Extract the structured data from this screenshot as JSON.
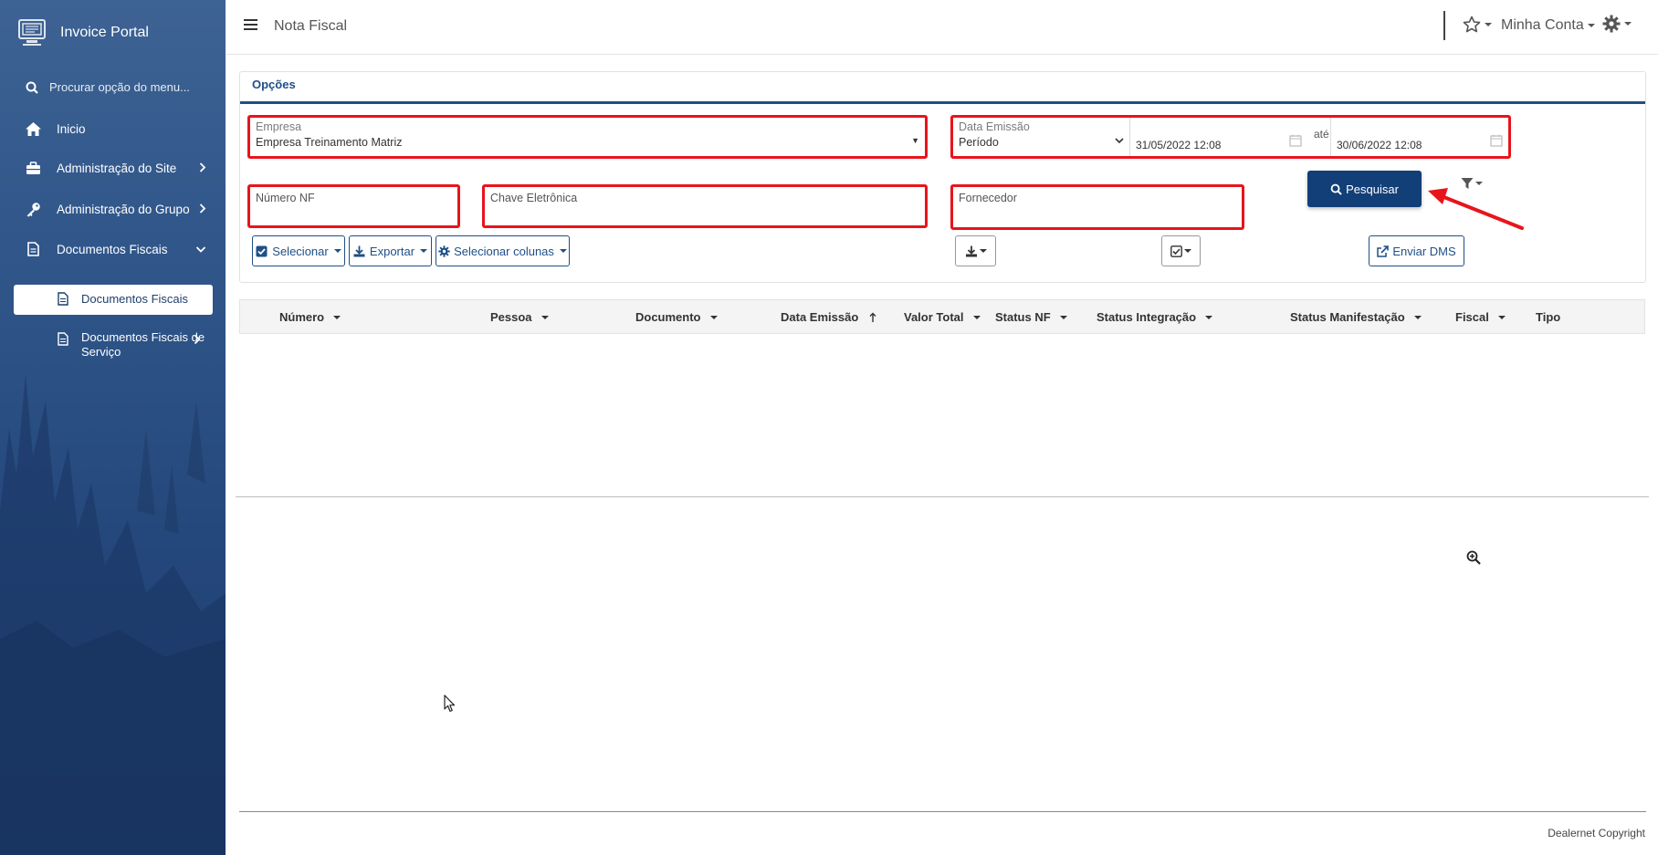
{
  "sidebar": {
    "brand": "Invoice Portal",
    "search_placeholder": "Procurar opção do menu...",
    "items": [
      {
        "label": "Inicio"
      },
      {
        "label": "Administração do Site"
      },
      {
        "label": "Administração do Grupo"
      },
      {
        "label": "Documentos Fiscais"
      }
    ],
    "subitems": [
      {
        "label": "Documentos Fiscais",
        "active": true
      },
      {
        "label_line1": "Documentos Fiscais de",
        "label_line2": "Serviço"
      }
    ]
  },
  "header": {
    "title": "Nota Fiscal",
    "account": "Minha Conta"
  },
  "options": {
    "title": "Opções",
    "empresa": {
      "label": "Empresa",
      "value": "Empresa Treinamento Matriz"
    },
    "data_emissao": {
      "label": "Data Emissão",
      "value": "Período"
    },
    "date_from": "31/05/2022 12:08",
    "date_sep": "até",
    "date_to": "30/06/2022 12:08",
    "numero_nf": {
      "label": "Número NF"
    },
    "chave": {
      "label": "Chave Eletrônica"
    },
    "fornecedor": {
      "label": "Fornecedor"
    },
    "search_button": "Pesquisar",
    "selecionar_button": "Selecionar",
    "exportar_button": "Exportar",
    "colunas_button": "Selecionar colunas",
    "enviar_dms_button": "Enviar DMS"
  },
  "table": {
    "columns": [
      "Número",
      "Pessoa",
      "Documento",
      "Data Emissão",
      "Valor Total",
      "Status NF",
      "Status Integração",
      "Status Manifestação",
      "Fiscal",
      "Tipo"
    ]
  },
  "footer": {
    "copyright": "Dealernet Copyright"
  },
  "colors": {
    "primary": "#123f78",
    "highlight": "#e8141b",
    "sidebar": "#2e5488"
  }
}
